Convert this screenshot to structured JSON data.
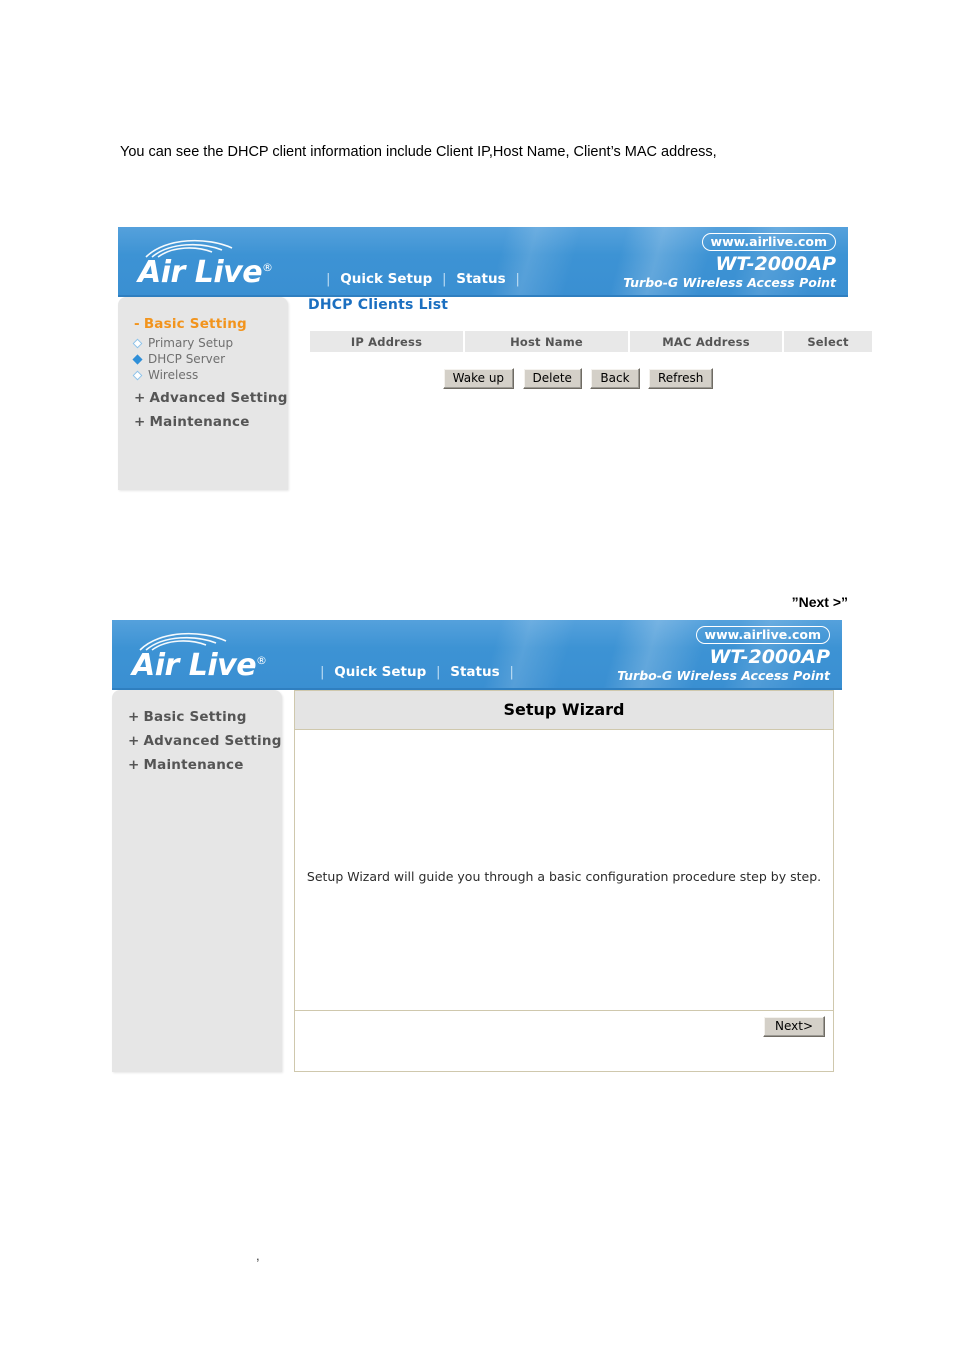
{
  "document": {
    "intro_text": "You can see the DHCP client information include Client IP,Host Name, Client’s MAC address,",
    "next_caption": "”Next >”",
    "stray_mark": ","
  },
  "brand": {
    "logo_text": "Air Live",
    "logo_registered": "®",
    "logo_waves_icon": "wifi-waves-icon",
    "url_badge": "www.airlive.com",
    "model": "WT-2000AP",
    "model_description": "Turbo-G Wireless Access Point",
    "banner_color": "#3d93d4",
    "accent_orange": "#f2941d",
    "title_blue": "#1b6fc0"
  },
  "banner_nav": {
    "separator": "|",
    "items": [
      {
        "label": "Quick Setup"
      },
      {
        "label": "Status"
      }
    ]
  },
  "screen_dhcp": {
    "sidebar": {
      "groups": [
        {
          "marker": "-",
          "label": "Basic Setting",
          "active": true,
          "children": [
            {
              "label": "Primary Setup",
              "selected": false
            },
            {
              "label": "DHCP Server",
              "selected": true
            },
            {
              "label": "Wireless",
              "selected": false
            }
          ]
        },
        {
          "marker": "+",
          "label": "Advanced Setting",
          "active": false,
          "children": []
        },
        {
          "marker": "+",
          "label": "Maintenance",
          "active": false,
          "children": []
        }
      ]
    },
    "page_title": "DHCP Clients List",
    "table": {
      "columns": [
        "IP Address",
        "Host Name",
        "MAC Address",
        "Select"
      ],
      "rows": []
    },
    "buttons": [
      {
        "label": "Wake up"
      },
      {
        "label": "Delete"
      },
      {
        "label": "Back"
      },
      {
        "label": "Refresh"
      }
    ]
  },
  "screen_wizard": {
    "sidebar": {
      "groups": [
        {
          "marker": "+",
          "label": "Basic Setting",
          "active": false,
          "children": []
        },
        {
          "marker": "+",
          "label": "Advanced Setting",
          "active": false,
          "children": []
        },
        {
          "marker": "+",
          "label": "Maintenance",
          "active": false,
          "children": []
        }
      ]
    },
    "panel_title": "Setup Wizard",
    "message": "Setup Wizard will guide you through a basic configuration procedure step by step.",
    "next_button": "Next>"
  }
}
